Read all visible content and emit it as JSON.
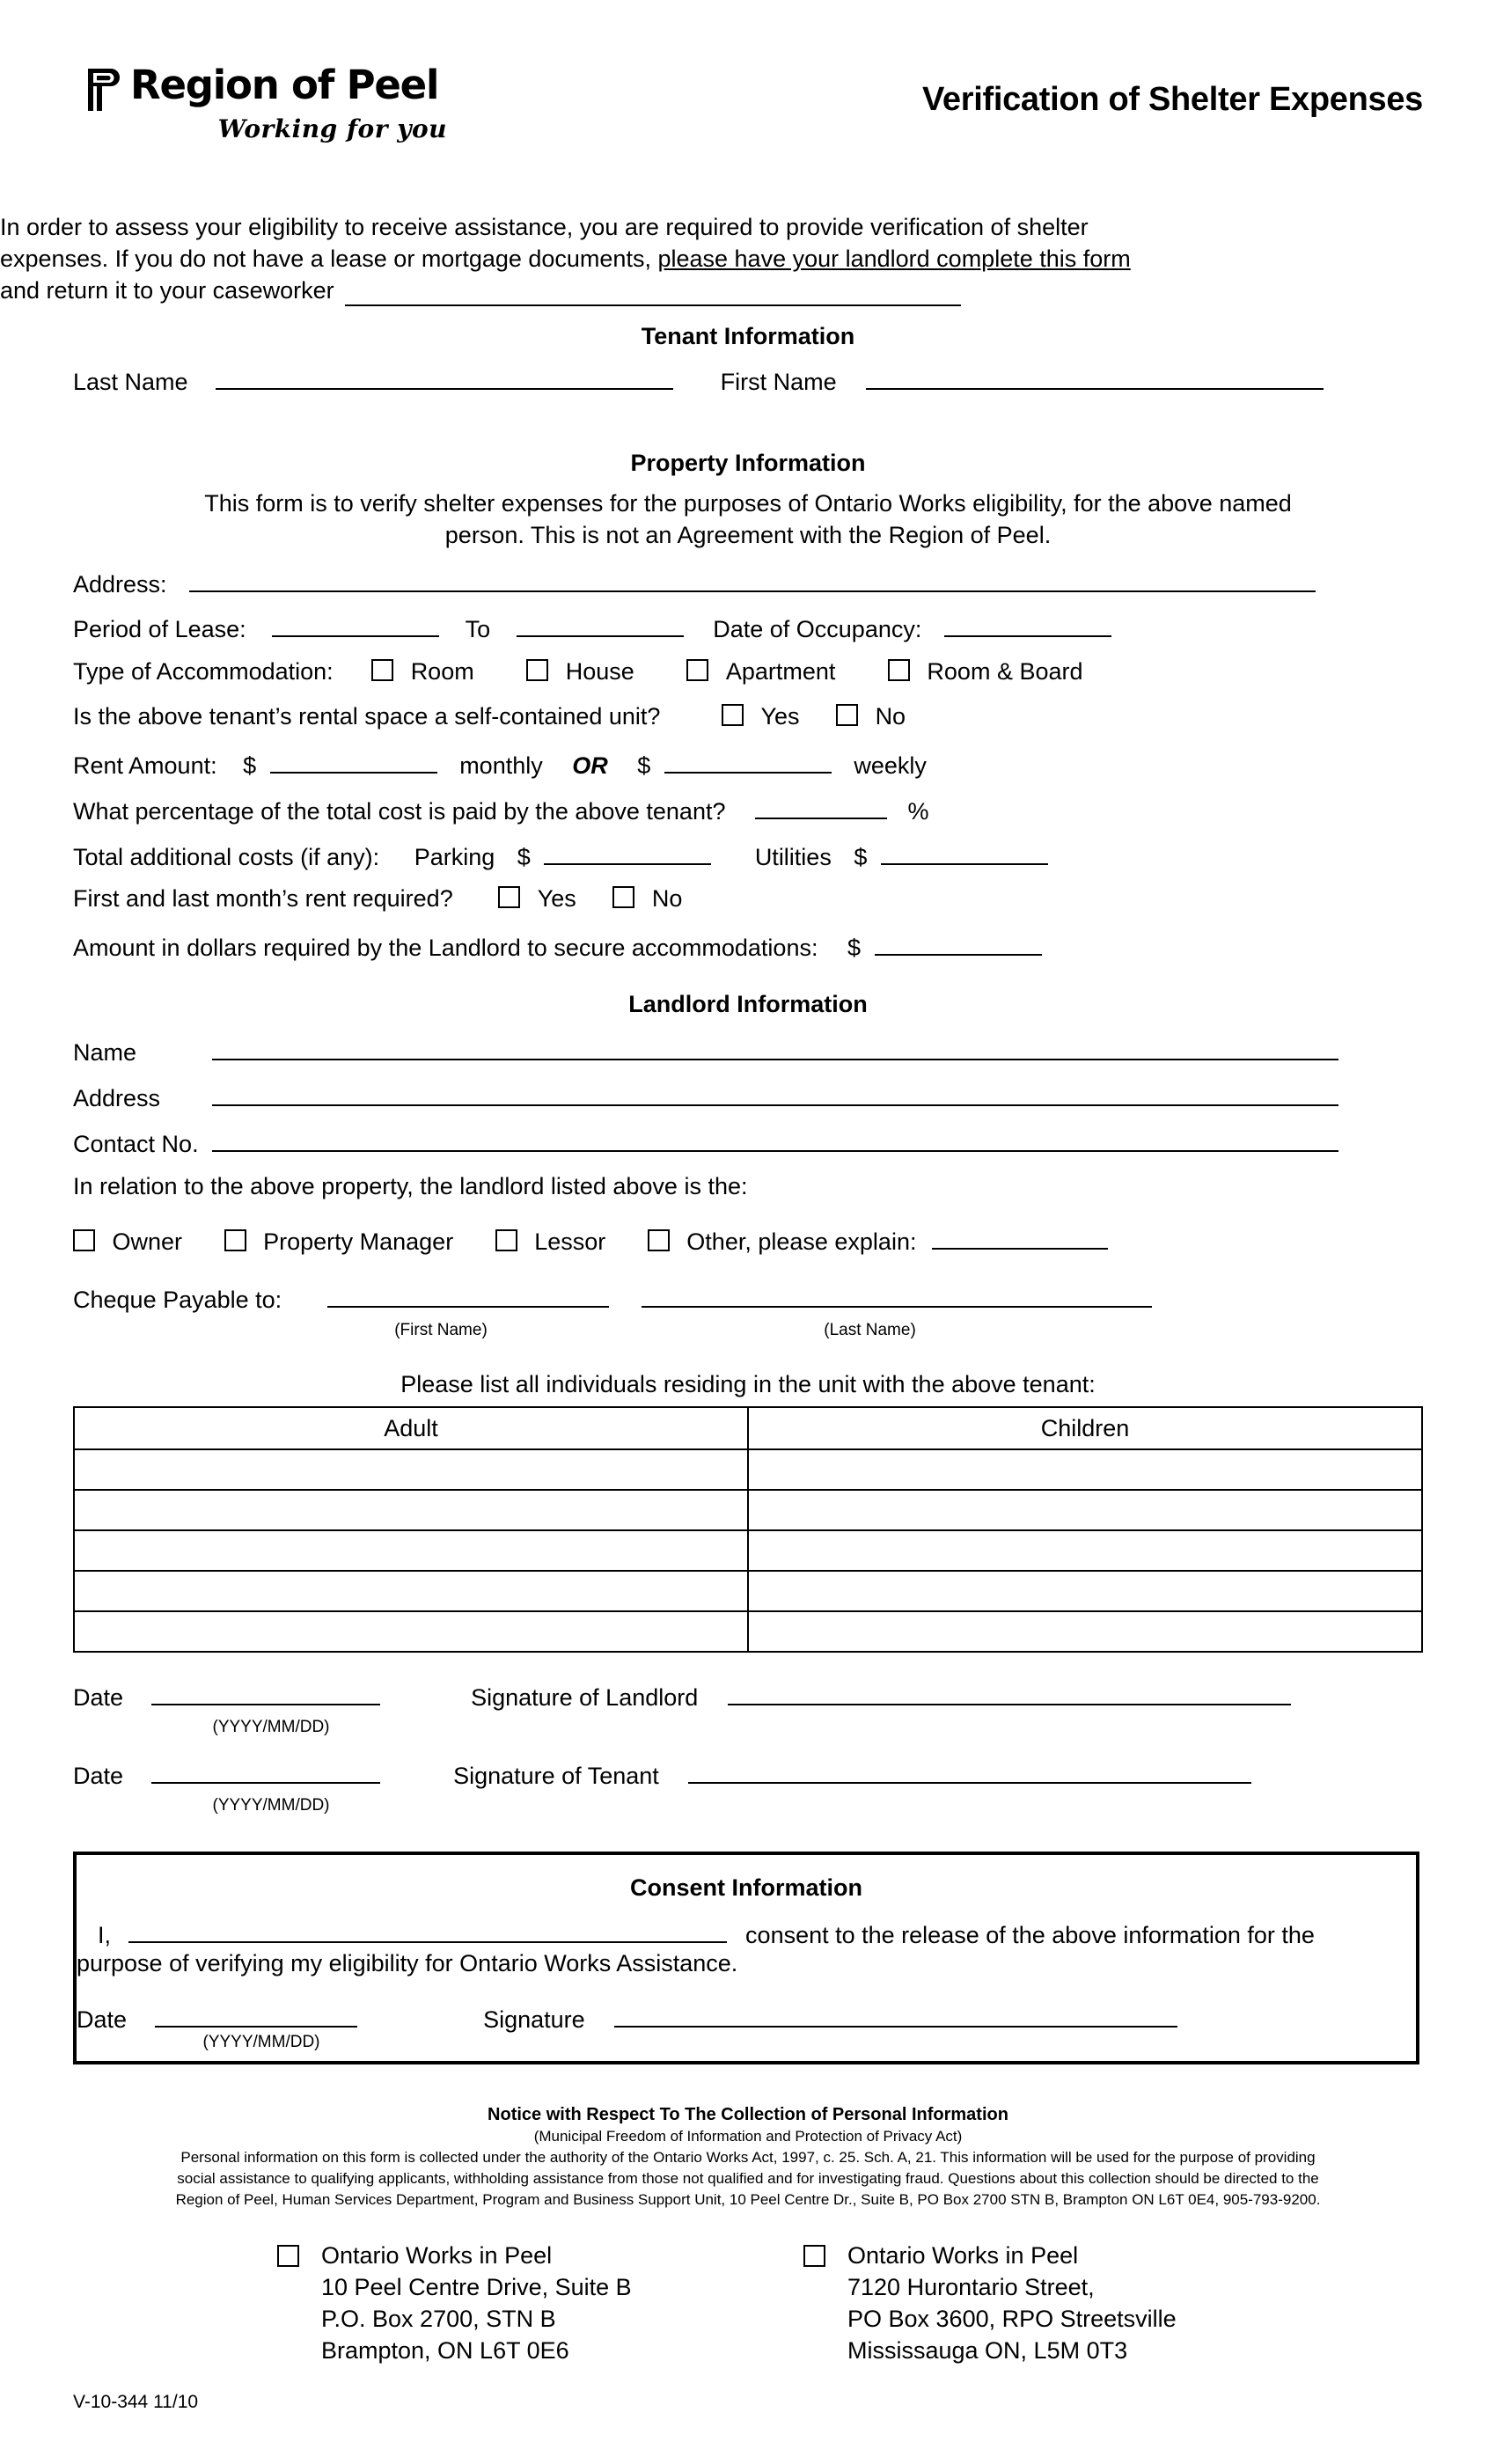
{
  "header": {
    "logo_word": "Region of Peel",
    "logo_tagline": "Working for you",
    "title": "Verification of Shelter Expenses"
  },
  "intro": {
    "line1": "In order to assess your eligibility to receive assistance, you are required to provide verification of shelter",
    "line2a": "expenses.  If you do not have a lease or mortgage documents, ",
    "line2b_underlined": "please have your landlord complete this form",
    "line3": "and return it to your caseworker"
  },
  "tenant": {
    "heading": "Tenant Information",
    "last_name_label": "Last Name",
    "first_name_label": "First Name",
    "last_name_value": "",
    "first_name_value": ""
  },
  "property": {
    "heading": "Property Information",
    "statement_line1": "This form is to verify shelter expenses for the purposes of Ontario Works eligibility, for the above named",
    "statement_line2": "person.  This is not an Agreement with the Region of Peel.",
    "address_label": "Address:",
    "address_value": "",
    "period_label": "Period of Lease:",
    "period_from_value": "",
    "period_to_label": "To",
    "period_to_value": "",
    "occupancy_label": "Date of Occupancy:",
    "occupancy_value": "",
    "accommodation_label": "Type of Accommodation:",
    "accommodation_options": [
      "Room",
      "House",
      "Apartment",
      "Room & Board"
    ],
    "selfcontained_question": "Is the above tenant’s rental space a self-contained unit?",
    "selfcontained_options": [
      "Yes",
      "No"
    ],
    "rent_label": "Rent Amount:",
    "currency": "$",
    "rent_monthly_value": "",
    "rent_monthly_label": "monthly",
    "or_label": "OR",
    "rent_weekly_value": "",
    "rent_weekly_label": "weekly",
    "percentage_question": "What percentage of the total cost is paid by the above tenant?",
    "percentage_value": "",
    "percent_symbol": "%",
    "additional_label": "Total additional costs (if any):",
    "parking_label": "Parking",
    "parking_value": "",
    "utilities_label": "Utilities",
    "utilities_value": "",
    "firstlast_question": "First and last month’s rent required?",
    "firstlast_options": [
      "Yes",
      "No"
    ],
    "secure_label": "Amount in dollars required by the Landlord to secure accommodations:",
    "secure_value": ""
  },
  "landlord": {
    "heading": "Landlord Information",
    "name_label": "Name",
    "name_value": "",
    "address_label": "Address",
    "address_value": "",
    "contact_label": "Contact No.",
    "contact_value": "",
    "relation_question": "In relation to the above property, the landlord listed above is the:",
    "relation_options": [
      "Owner",
      "Property Manager",
      "Lessor",
      "Other, please explain:"
    ],
    "other_value": "",
    "cheque_label": "Cheque Payable to:",
    "cheque_first_value": "",
    "cheque_last_value": "",
    "cheque_first_caption": "(First Name)",
    "cheque_last_caption": "(Last Name)"
  },
  "residents": {
    "caption": "Please list all individuals residing in the unit with the above tenant:",
    "columns": [
      "Adult",
      "Children"
    ],
    "rows": [
      [
        "",
        ""
      ],
      [
        "",
        ""
      ],
      [
        "",
        ""
      ],
      [
        "",
        ""
      ],
      [
        "",
        ""
      ]
    ]
  },
  "signatures": {
    "date_label": "Date",
    "date_format_caption": "(YYYY/MM/DD)",
    "landlord_sig_label": "Signature of Landlord",
    "tenant_sig_label": "Signature of Tenant",
    "landlord_date_value": "",
    "tenant_date_value": "",
    "landlord_sig_value": "",
    "tenant_sig_value": ""
  },
  "consent": {
    "heading": "Consent Information",
    "i_label": "I,",
    "name_value": "",
    "text_after_name": "consent to the release of the above information for the",
    "line2": "purpose of verifying my eligibility for Ontario Works Assistance.",
    "date_label": "Date",
    "date_value": "",
    "date_format_caption": "(YYYY/MM/DD)",
    "signature_label": "Signature",
    "signature_value": ""
  },
  "notice": {
    "title": "Notice with Respect To The Collection of Personal Information",
    "subtitle": "(Municipal Freedom of Information and Protection of Privacy Act)",
    "body_line1": "Personal information on this form is collected under the authority of the Ontario Works Act, 1997, c. 25. Sch. A, 21.  This information will be used for the purpose of providing",
    "body_line2": "social assistance to qualifying applicants, withholding assistance from those not qualified and for investigating fraud.  Questions about this collection should be directed to the",
    "body_line3": "Region of Peel, Human Services Department, Program and Business Support Unit, 10 Peel Centre Dr., Suite B, PO Box 2700 STN B, Brampton ON  L6T 0E4, 905-793-9200."
  },
  "offices": [
    {
      "name": "Ontario Works in Peel",
      "line1": "10 Peel Centre Drive, Suite B",
      "line2": "P.O. Box 2700, STN B",
      "line3": "Brampton, ON  L6T 0E6"
    },
    {
      "name": "Ontario Works in Peel",
      "line1": "7120 Hurontario Street,",
      "line2": "PO Box 3600, RPO Streetsville",
      "line3": "Mississauga ON, L5M 0T3"
    }
  ],
  "form_code": "V-10-344 11/10"
}
